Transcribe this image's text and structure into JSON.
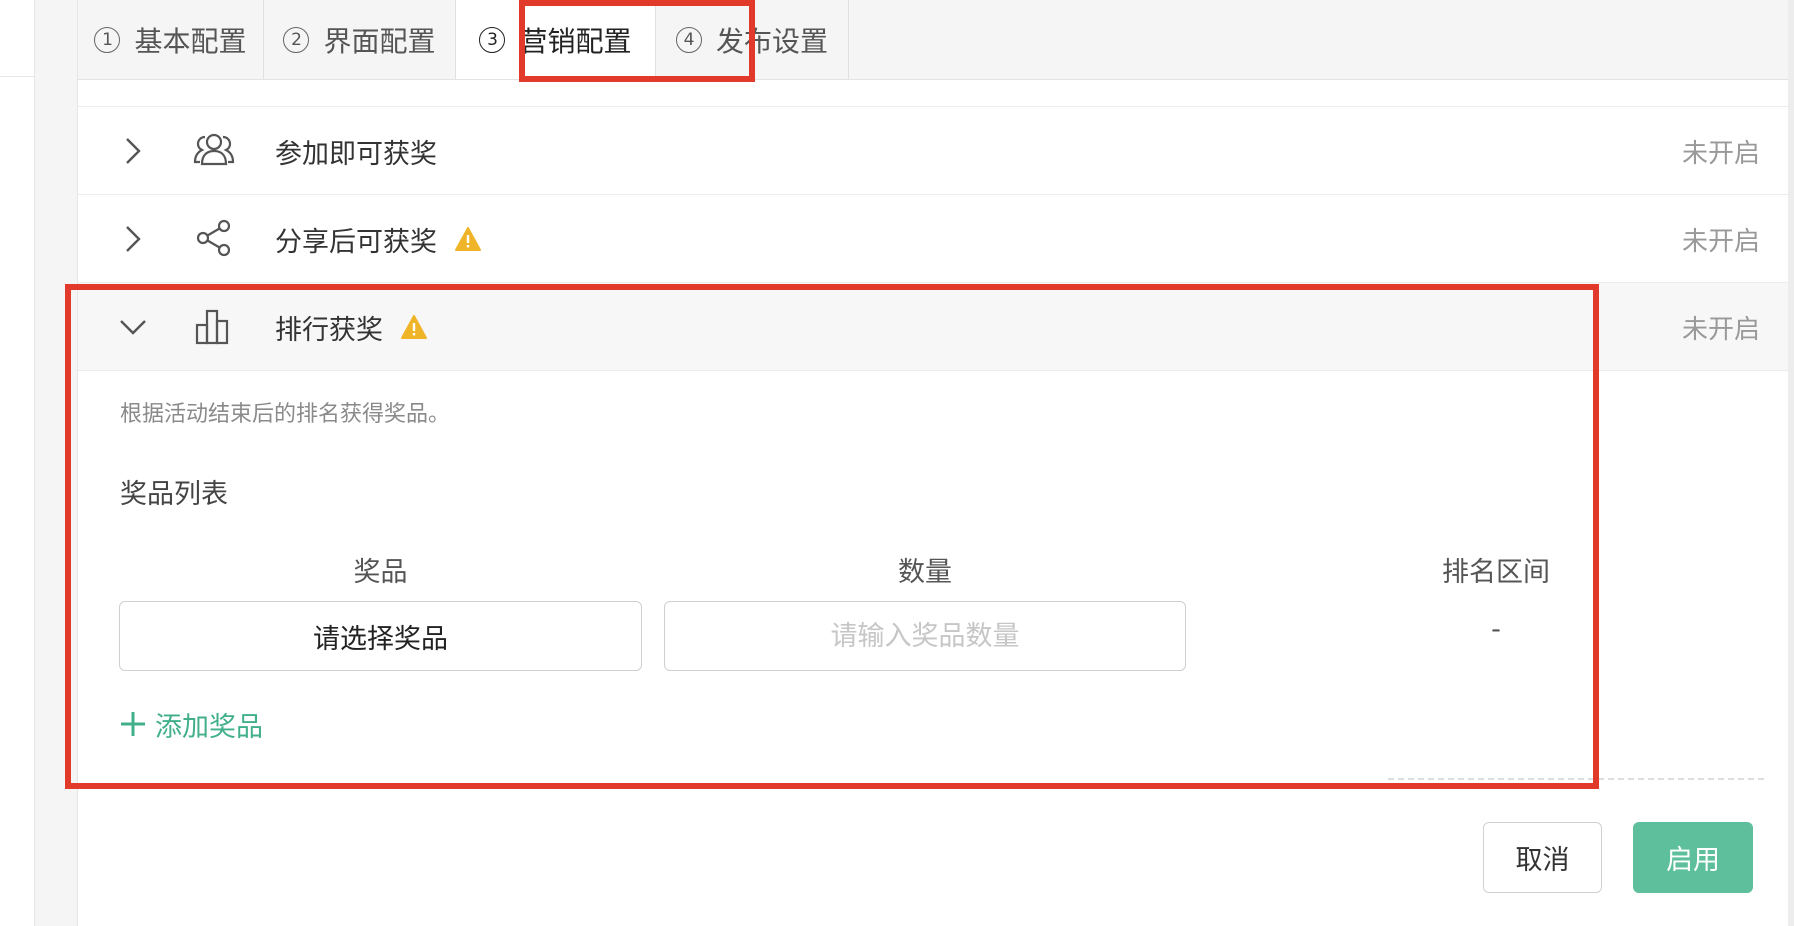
{
  "tabs": [
    {
      "num": "1",
      "label": "基本配置"
    },
    {
      "num": "2",
      "label": "界面配置"
    },
    {
      "num": "3",
      "label": "营销配置"
    },
    {
      "num": "4",
      "label": "发布设置"
    }
  ],
  "active_tab": "营销配置",
  "rows": [
    {
      "title": "参加即可获奖",
      "status": "未开启",
      "icon": "users-icon"
    },
    {
      "title": "分享后可获奖",
      "status": "未开启",
      "icon": "share-icon",
      "warning": true
    },
    {
      "title": "排行获奖",
      "status": "未开启",
      "icon": "bar-chart-icon",
      "warning": true,
      "expanded": true
    }
  ],
  "panel": {
    "description": "根据活动结束后的排名获得奖品。",
    "section_title": "奖品列表",
    "columns": {
      "prize": "奖品",
      "quantity": "数量",
      "rank_range": "排名区间"
    },
    "prize_select_label": "请选择奖品",
    "quantity_placeholder": "请输入奖品数量",
    "rank_value": "-",
    "add_prize_label": "添加奖品"
  },
  "footer": {
    "cancel_label": "取消",
    "enable_label": "启用"
  },
  "colors": {
    "accent": "#5dbf9b",
    "link": "#41b08a",
    "warning": "#f0b429",
    "highlight": "#e23a2a"
  }
}
